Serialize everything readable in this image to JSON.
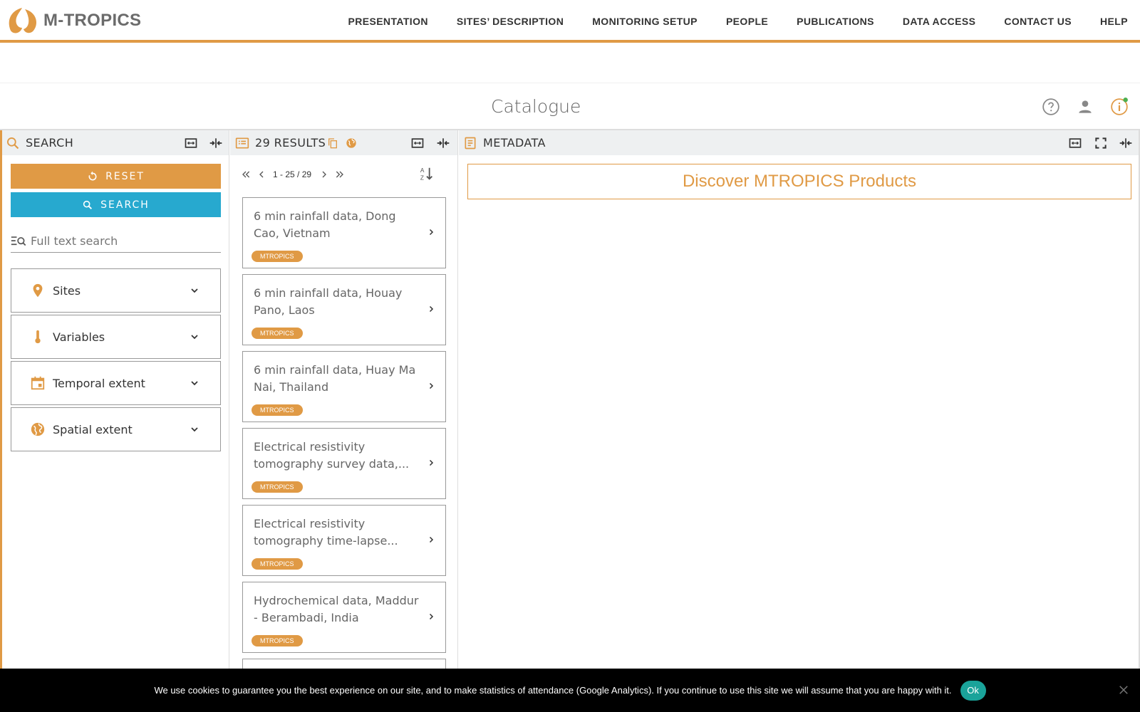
{
  "brand": {
    "name": "M-TROPICS",
    "color": "#e09a45"
  },
  "nav": [
    {
      "label": "PRESENTATION"
    },
    {
      "label": "SITES’ DESCRIPTION"
    },
    {
      "label": "MONITORING SETUP"
    },
    {
      "label": "PEOPLE"
    },
    {
      "label": "PUBLICATIONS"
    },
    {
      "label": "DATA ACCESS"
    },
    {
      "label": "CONTACT US"
    },
    {
      "label": "HELP"
    }
  ],
  "catalogue": {
    "title": "Catalogue",
    "icons": [
      "help-icon",
      "user-icon",
      "info-icon"
    ]
  },
  "search_panel": {
    "title": "SEARCH",
    "reset_label": "RESET",
    "search_label": "SEARCH",
    "fulltext_placeholder": "Full text search",
    "facets": [
      {
        "label": "Sites",
        "icon": "map-pin-icon"
      },
      {
        "label": "Variables",
        "icon": "thermometer-icon"
      },
      {
        "label": "Temporal extent",
        "icon": "calendar-icon"
      },
      {
        "label": "Spatial extent",
        "icon": "globe-icon"
      }
    ]
  },
  "results_panel": {
    "title": "29 RESULTS",
    "pagination": "1 - 25 / 29",
    "items": [
      {
        "title": "6 min rainfall data, Dong Cao, Vietnam",
        "badge": "MTROPICS"
      },
      {
        "title": "6 min rainfall data, Houay Pano, Laos",
        "badge": "MTROPICS"
      },
      {
        "title": "6 min rainfall data, Huay Ma Nai, Thailand",
        "badge": "MTROPICS"
      },
      {
        "title": "Electrical resistivity tomography survey data,...",
        "badge": "MTROPICS"
      },
      {
        "title": "Electrical resistivity tomography time-lapse...",
        "badge": "MTROPICS"
      },
      {
        "title": "Hydrochemical data, Maddur - Berambadi, India",
        "badge": "MTROPICS"
      }
    ]
  },
  "metadata_panel": {
    "title": "METADATA",
    "discover_label": "Discover MTROPICS Products"
  },
  "cookie": {
    "text": "We use cookies to guarantee you the best experience on our site, and to make statistics of attendance (Google Analytics). If you continue to use this site we will assume that you are happy with it.",
    "ok_label": "Ok"
  }
}
